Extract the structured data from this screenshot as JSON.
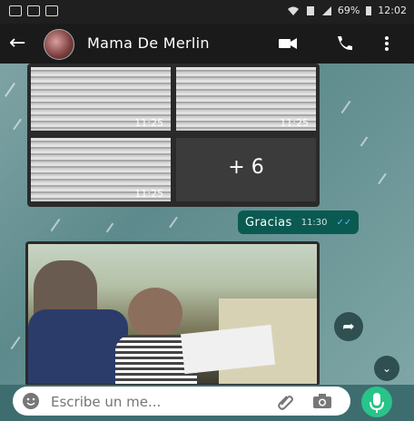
{
  "status": {
    "battery": "69%",
    "time": "12:02"
  },
  "header": {
    "contact_name": "Mama De Merlin"
  },
  "messages": {
    "grid_times": [
      "11:25",
      "11:25",
      "11:25"
    ],
    "more_count": "+ 6",
    "outgoing": {
      "text": "Gracias",
      "time": "11:30"
    }
  },
  "composer": {
    "placeholder": "Escribe un me..."
  },
  "colors": {
    "accent": "#28c48a",
    "bubble_out": "#0a5a52",
    "ticks": "#59b5ff"
  }
}
